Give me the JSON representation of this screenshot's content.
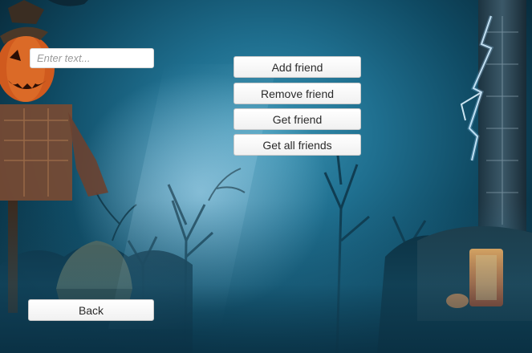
{
  "screen": {
    "background": "haunted-forest-halloween-illustration",
    "accent_colors": [
      "#1f6f8f",
      "#0f4a63",
      "#e8642a"
    ]
  },
  "input": {
    "placeholder": "Enter text...",
    "value": ""
  },
  "menu": {
    "add_friend": "Add friend",
    "remove_friend": "Remove friend",
    "get_friend": "Get friend",
    "get_all_friends": "Get all friends"
  },
  "footer": {
    "back": "Back"
  }
}
